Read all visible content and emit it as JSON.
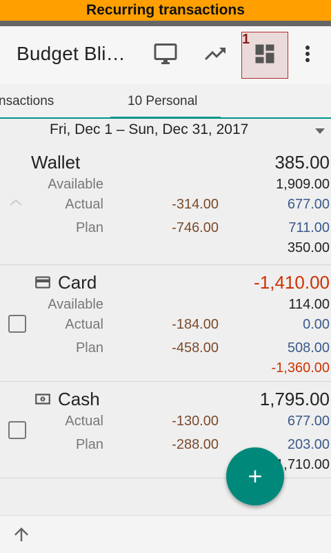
{
  "banner": {
    "text": "Recurring transactions"
  },
  "appbar": {
    "title": "Budget Bli…",
    "icons": [
      "monitor-icon",
      "trending-up-icon",
      "dashboard-icon",
      "more-vert-icon"
    ],
    "highlight_number": "1"
  },
  "tabs": [
    {
      "label": "nsactions",
      "selected": false
    },
    {
      "label": "10 Personal",
      "selected": true
    }
  ],
  "date_range": {
    "label": "Fri, Dec 1 – Sun, Dec 31, 2017"
  },
  "accounts": [
    {
      "name": "Wallet",
      "icon": "",
      "balance": "385.00",
      "available_label": "Available",
      "available": "1,909.00",
      "actual_label": "Actual",
      "actual_spent": "-314.00",
      "actual_value": "677.00",
      "plan_label": "Plan",
      "plan_spent": "-746.00",
      "plan_value": "711.00",
      "total": "350.00"
    },
    {
      "name": "Card",
      "icon": "credit-card-icon",
      "balance": "-1,410.00",
      "available_label": "Available",
      "available": "114.00",
      "actual_label": "Actual",
      "actual_spent": "-184.00",
      "actual_value": "0.00",
      "plan_label": "Plan",
      "plan_spent": "-458.00",
      "plan_value": "508.00",
      "total": "-1,360.00"
    },
    {
      "name": "Cash",
      "icon": "cash-icon",
      "balance": "1,795.00",
      "actual_label": "Actual",
      "actual_spent": "-130.00",
      "actual_value": "677.00",
      "plan_label": "Plan",
      "plan_spent": "-288.00",
      "plan_value": "203.00",
      "total": "1,710.00"
    }
  ],
  "colors": {
    "accent": "#009688",
    "fab": "#00897b",
    "negative": "#cc3300",
    "banner": "#ffa000"
  }
}
